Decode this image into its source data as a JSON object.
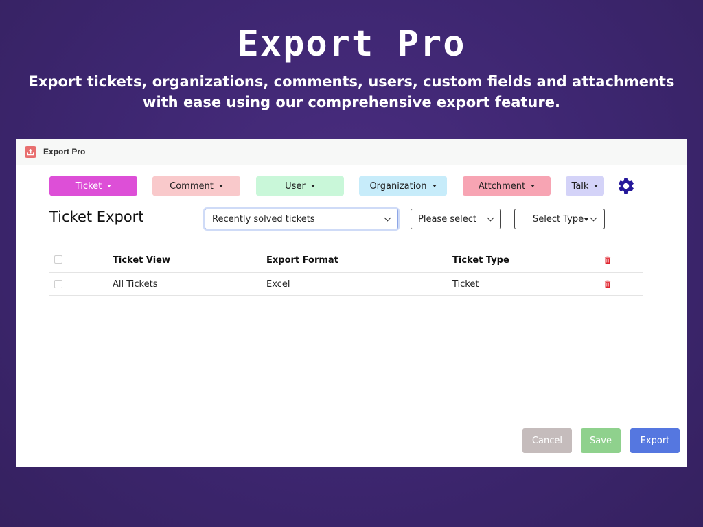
{
  "hero": {
    "title": "Export Pro",
    "subtitle_line1": "Export tickets, organizations, comments, users, custom fields and attachments",
    "subtitle_line2": "with ease using our comprehensive export feature."
  },
  "window": {
    "title": "Export Pro",
    "icon": "export-app-icon"
  },
  "nav": {
    "tabs": [
      {
        "label": "Ticket",
        "bg": "#dd4fd7",
        "color": "#ffffff"
      },
      {
        "label": "Comment",
        "bg": "#f9c9cb",
        "color": "#222222"
      },
      {
        "label": "User",
        "bg": "#c9f7d9",
        "color": "#222222"
      },
      {
        "label": "Organization",
        "bg": "#c7ecfa",
        "color": "#222222"
      },
      {
        "label": "Attchment",
        "bg": "#f7a4b3",
        "color": "#222222"
      },
      {
        "label": "Talk",
        "bg": "#d4d3f8",
        "color": "#222222"
      }
    ],
    "settings_icon": "gear-icon",
    "settings_color": "#25189a"
  },
  "export": {
    "heading": "Ticket Export",
    "view_select": "Recently solved tickets",
    "format_select": "Please select",
    "type_select": "Select Type"
  },
  "table": {
    "headers": [
      "Ticket View",
      "Export Format",
      "Ticket Type"
    ],
    "rows": [
      {
        "view": "All Tickets",
        "format": "Excel",
        "type": "Ticket"
      }
    ],
    "delete_icon": "trash-icon",
    "delete_color": "#e0242e"
  },
  "actions": {
    "cancel": "Cancel",
    "save": "Save",
    "export": "Export",
    "cancel_color": "#c5bcbc",
    "save_color": "#8fd18d",
    "export_color": "#5577e0"
  }
}
